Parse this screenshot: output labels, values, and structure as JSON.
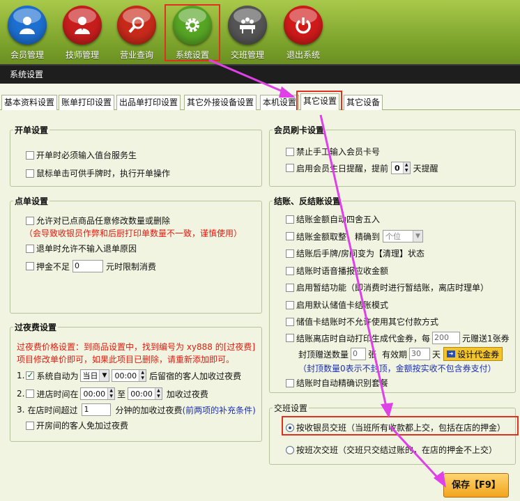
{
  "nav": [
    {
      "label": "会员管理",
      "icon": "member-icon",
      "color": "#1d6fd0"
    },
    {
      "label": "技师管理",
      "icon": "technician-icon",
      "color": "#c81d1d"
    },
    {
      "label": "营业查询",
      "icon": "search-icon",
      "color": "#c82a1a"
    },
    {
      "label": "系统设置",
      "icon": "gear-icon",
      "color": "#57a525"
    },
    {
      "label": "交班管理",
      "icon": "meeting-icon",
      "color": "#555555"
    },
    {
      "label": "退出系统",
      "icon": "power-icon",
      "color": "#d01a1a"
    }
  ],
  "window_title": "系统设置",
  "tabs": [
    "基本资料设置",
    "账单打印设置",
    "出品单打印设置",
    "其它外接设备设置",
    "本机设置",
    "其它设置",
    "其它设备"
  ],
  "open_bill": {
    "title": "开单设置",
    "items": [
      "开单时必须输入值台服务生",
      "鼠标单击可供手牌时，执行开单操作"
    ]
  },
  "order": {
    "title": "点单设置",
    "item1": "允许对已点商品任意修改数量或删除",
    "warning": "（会导致收银员作弊和后厨打印单数量不一致，谨慎使用）",
    "item2": "退单时允许不输入退单原因",
    "deposit_pre": "押金不足",
    "deposit_value": "0",
    "deposit_post": "元时限制消费"
  },
  "overnight": {
    "title": "过夜费设置",
    "note1": "过夜费价格设置：到商品设置中，找到编号为 xy888 的[过夜费]",
    "note2": "项目修改单价即可，如果此项目已删除，请重新添加即可。",
    "r1_num": "1.",
    "r1_label": "系统自动为",
    "r1_day": "当日",
    "r1_time": "00:00",
    "r1_post": "后留宿的客人加收过夜费",
    "r2_num": "2.",
    "r2_label": "进店时间在",
    "r2_from": "00:00",
    "r2_to_label": "至",
    "r2_to": "00:00",
    "r2_post": "加收过夜费",
    "r3_num": "3.",
    "r3_label": "在店时间超过",
    "r3_value": "1",
    "r3_post": "分钟的加收过夜费",
    "r3_note": "(前两项的补充条件)",
    "r4_label": "开房间的客人免加过夜费"
  },
  "card": {
    "title": "会员刷卡设置",
    "item1": "禁止手工输入会员卡号",
    "item2_pre": "启用会员生日提醒，提前",
    "item2_value": "0",
    "item2_post": "天提醒"
  },
  "checkout": {
    "title": "结账、反结账设置",
    "items": [
      "结账金额自动四舍五入",
      "结账金额取整，精确到",
      "结账后手牌/房间变为【清理】状态",
      "结账时语音播报应收金额",
      "启用暂结功能（即消费时进行暂结账，离店时理单）",
      "启用默认储值卡结账模式",
      "储值卡结账时不允许使用其它付款方式"
    ],
    "round_option": "个位",
    "voucher_pre": "结账离店时自动打印生成代金券，每",
    "voucher_amount": "200",
    "voucher_post": "元赠送1张券",
    "cap_pre": "封顶赠送数量",
    "cap_value": "0",
    "cap_unit": "张",
    "valid_pre": "有效期",
    "valid_value": "30",
    "valid_unit": "天",
    "design_label": "设计代金券",
    "cap_note": "（封顶数量0表示不封顶，金额按实收不包含券支付）",
    "last_item": "结账时自动精确识别套餐"
  },
  "shift": {
    "title": "交班设置",
    "opt1": "按收银员交班（当班所有收款都上交，包括在店的押金）",
    "opt2": "按班次交班（交班只交结过账的，在店的押金不上交）"
  },
  "save_label": "保存【F9】",
  "colors": {
    "accent_frame": "#e03020",
    "arrow": "#e040e8",
    "warning_text": "#e41a0e",
    "note_text": "#1c2fb8"
  }
}
